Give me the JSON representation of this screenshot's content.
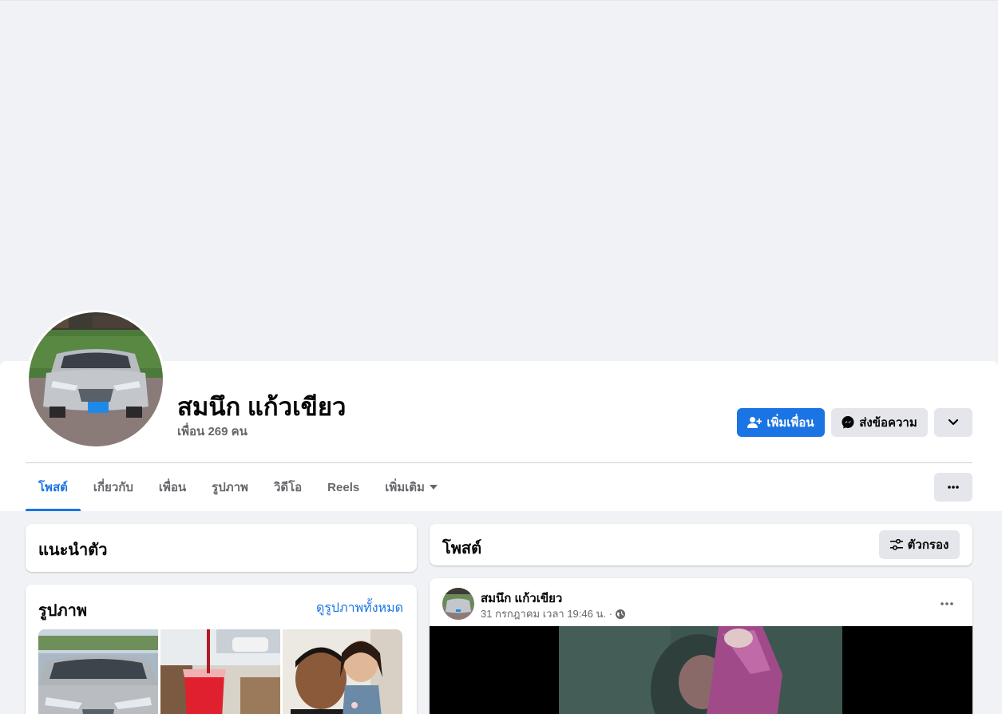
{
  "profile": {
    "name": "สมนึก แก้วเขียว",
    "friends": "เพื่อน 269 คน"
  },
  "actions": {
    "add_friend": "เพิ่มเพื่อน",
    "message": "ส่งข้อความ"
  },
  "tabs": [
    {
      "label": "โพสต์",
      "active": true
    },
    {
      "label": "เกี่ยวกับ",
      "active": false
    },
    {
      "label": "เพื่อน",
      "active": false
    },
    {
      "label": "รูปภาพ",
      "active": false
    },
    {
      "label": "วิดีโอ",
      "active": false
    },
    {
      "label": "Reels",
      "active": false
    },
    {
      "label": "เพิ่มเติม",
      "active": false
    }
  ],
  "intro": {
    "title": "แนะนำตัว"
  },
  "photos": {
    "title": "รูปภาพ",
    "see_all": "ดูรูปภาพทั้งหมด"
  },
  "posts": {
    "title": "โพสต์",
    "filter": "ตัวกรอง"
  },
  "post": {
    "author": "สมนึก แก้วเขียว",
    "timestamp": "31 กรกฎาคม เวลา 19:46 น. ·"
  },
  "colors": {
    "accent": "#1b74e4",
    "secondary_button": "#e4e6eb",
    "page_bg": "#f0f2f5",
    "muted_text": "#65676b"
  },
  "icons": {
    "add_friend": "add-friend-icon",
    "message": "messenger-icon",
    "chevron": "chevron-down-icon",
    "more": "more-dots-icon",
    "filter": "filter-icon",
    "audience": "globe-icon"
  }
}
